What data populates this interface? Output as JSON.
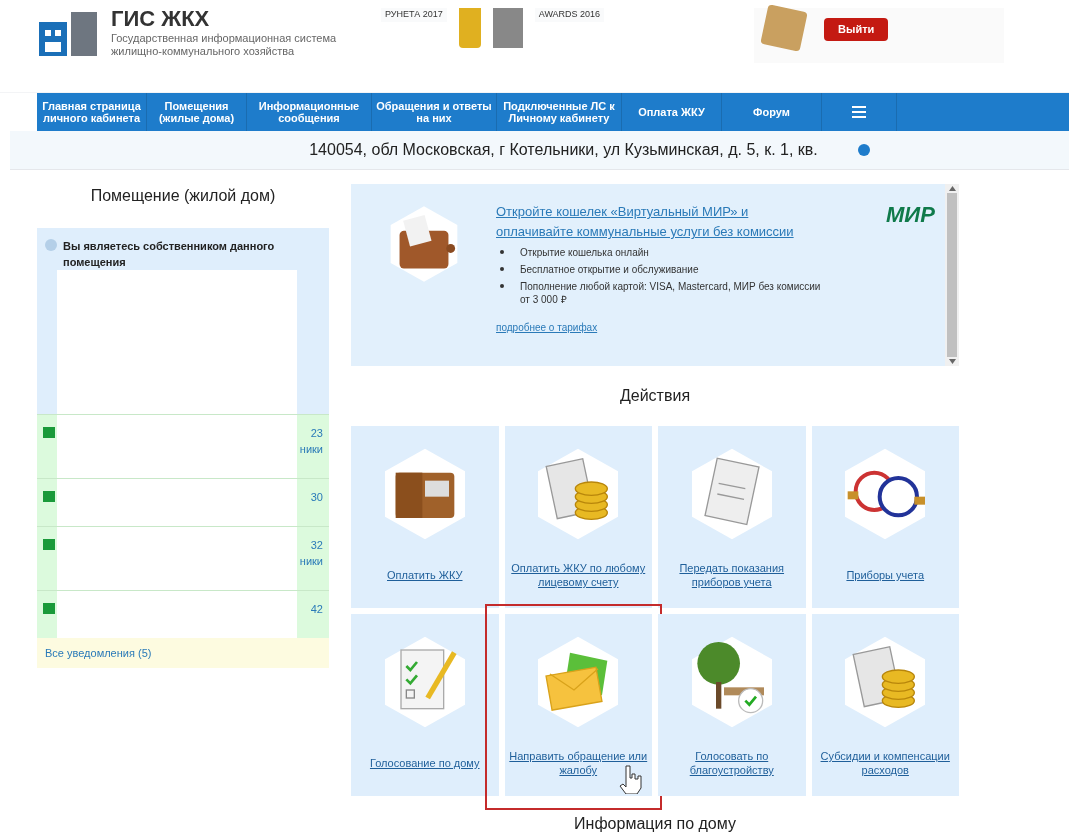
{
  "header": {
    "logo_title": "ГИС ЖКХ",
    "logo_subtitle": "Государственная информационная система жилищно-коммунального хозяйства",
    "awards": [
      "РУНЕТА 2017",
      "AWARDS 2016"
    ],
    "logout": "Выйти"
  },
  "nav": {
    "items": [
      {
        "label": "Главная страница личного кабинета"
      },
      {
        "label": "Помещения (жилые дома)"
      },
      {
        "label": "Информационные сообщения"
      },
      {
        "label": "Обращения и ответы на них"
      },
      {
        "label": "Подключенные ЛС к Личному кабинету"
      },
      {
        "label": "Оплата ЖКУ"
      },
      {
        "label": "Форум"
      }
    ]
  },
  "address": "140054, обл Московская, г Котельники, ул Кузьминская, д. 5, к. 1, кв.",
  "sidebar": {
    "title": "Помещение (жилой дом)",
    "info": "Вы являетесь собственником данного помещения",
    "notifications": [
      {
        "fragments": [
          "23",
          "ники"
        ]
      },
      {
        "fragments": [
          "30"
        ]
      },
      {
        "fragments": [
          "32",
          "ники"
        ]
      },
      {
        "fragments": [
          "42"
        ]
      }
    ],
    "all_link": "Все уведомления (5)"
  },
  "promo": {
    "title": "Откройте кошелек «Виртуальный МИР» и оплачивайте коммунальные услуги без комиссии",
    "bullets": [
      "Открытие кошелька онлайн",
      "Бесплатное открытие и обслуживание",
      "Пополнение любой картой: VISA, Mastercard, МИР без комиссии от 3 000 ₽"
    ],
    "more_link": "подробнее о тарифах",
    "brand": "МИР"
  },
  "actions": {
    "title": "Действия",
    "tiles": [
      {
        "label": "Оплатить ЖКУ",
        "kind": "wallet",
        "highlighted": false
      },
      {
        "label": "Оплатить ЖКУ по любому лицевому счету",
        "kind": "bill",
        "highlighted": false
      },
      {
        "label": "Передать показания приборов учета",
        "kind": "form",
        "highlighted": false
      },
      {
        "label": "Приборы учета",
        "kind": "meter",
        "highlighted": false
      },
      {
        "label": "Голосование по дому",
        "kind": "checklist",
        "highlighted": false
      },
      {
        "label": "Направить обращение или жалобу",
        "kind": "envelope",
        "highlighted": true
      },
      {
        "label": "Голосовать по благоустройству",
        "kind": "tree",
        "highlighted": false
      },
      {
        "label": "Субсидии и компенсации расходов",
        "kind": "bill",
        "highlighted": false
      }
    ]
  },
  "house_info_title": "Информация по дому"
}
